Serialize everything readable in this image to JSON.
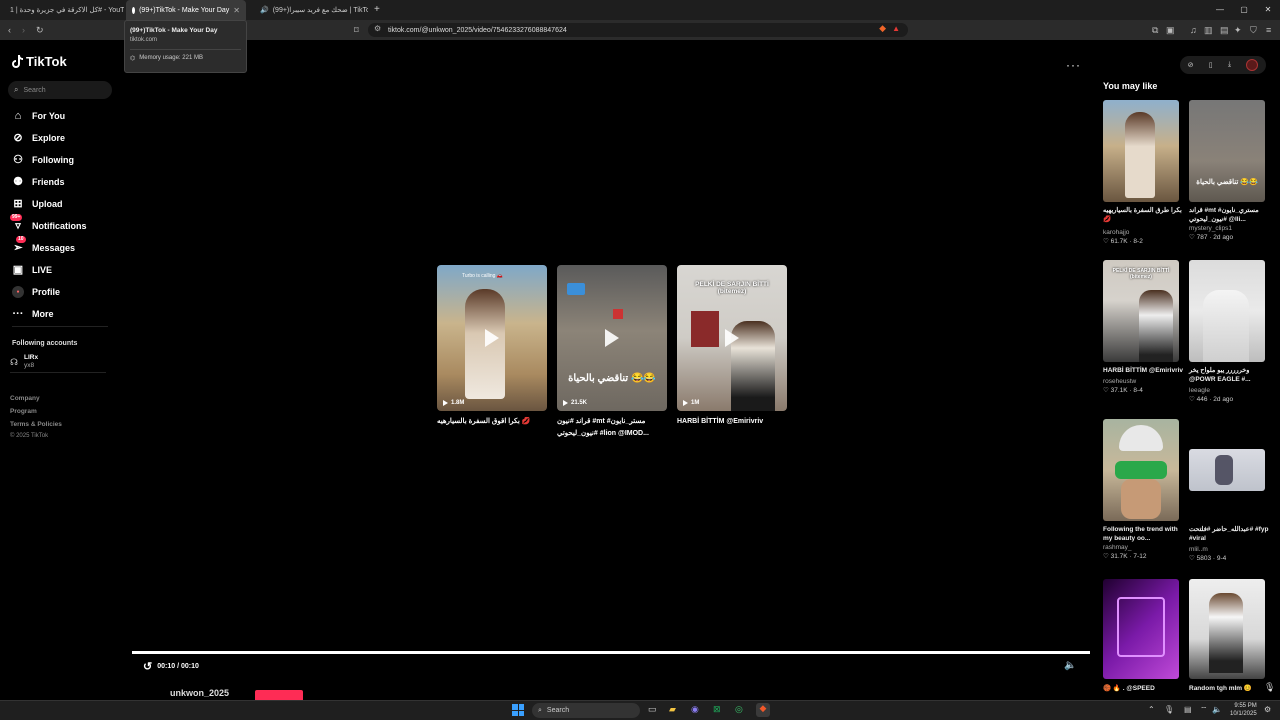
{
  "browser": {
    "tabs": [
      {
        "title": "كل الاكرقة في جزيرة وحدة | 1# - YouTube"
      },
      {
        "title": "(99+)TikTok - Make Your Day"
      },
      {
        "title": "(99+)ضحك مع فريد سيبرا | TikTok"
      }
    ],
    "new_tab": "+",
    "url": "tiktok.com/@unkwon_2025/video/7546233276088847624",
    "tooltip": {
      "title": "(99+)TikTok - Make Your Day",
      "domain": "tiktok.com",
      "memory": "Memory usage: 221 MB"
    }
  },
  "sidebar": {
    "logo": "TikTok",
    "search_placeholder": "Search",
    "items": [
      {
        "label": "For You",
        "icon": "home-icon"
      },
      {
        "label": "Explore",
        "icon": "compass-icon"
      },
      {
        "label": "Following",
        "icon": "following-icon"
      },
      {
        "label": "Friends",
        "icon": "friends-icon"
      },
      {
        "label": "Upload",
        "icon": "upload-icon"
      },
      {
        "label": "Notifications",
        "icon": "inbox-icon",
        "badge": "99+"
      },
      {
        "label": "Messages",
        "icon": "messages-icon",
        "badge": "10"
      },
      {
        "label": "LIVE",
        "icon": "live-icon"
      },
      {
        "label": "Profile",
        "icon": "avatar-icon"
      },
      {
        "label": "More",
        "icon": "more-icon"
      }
    ],
    "following_heading": "Following accounts",
    "following_account": {
      "name": "LIRx",
      "handle": "yx8"
    },
    "footer": [
      "Company",
      "Program",
      "Terms & Policies",
      "© 2025 TikTok"
    ]
  },
  "main": {
    "cards": [
      {
        "views": "1.8M",
        "caption": "بكرا اقوق السفرة بالسيارهيه 💋",
        "overlay": "Turbo is calling 🚗"
      },
      {
        "views": "21.5K",
        "caption": "قراند #نيون #mt #مستر_نايون #نيون_ليحوتي #lion @IMOD...",
        "overlay": "😂😂 تناقضي بالحياة"
      },
      {
        "views": "1M",
        "caption": "HARBİ BİTTİM @Emirivriv",
        "overlay": "PELKİ DE SARJIN BİTTİ\n(bitemez)"
      }
    ],
    "time": "00:10 / 00:10",
    "progress": 1.0,
    "author": "unkwon_2025"
  },
  "right_panel": {
    "heading": "You may like",
    "items": [
      {
        "title": "بكرا طرق السفرة بالسياريهيه 💋",
        "user": "karohajjo",
        "likes": "61.7K",
        "date": "8-2"
      },
      {
        "title": "قراند #mt #مستري_نايون #نيون_ليحوتي @lli...",
        "user": "mystery_clips1",
        "likes": "787",
        "date": "2d ago"
      },
      {
        "title": "HARBİ BİTTİM @Emirivriv",
        "user": "roseheustw",
        "likes": "37.1K",
        "date": "8-4"
      },
      {
        "title": "وخررررر يبو ملواح يخر @POWR EAGLE #...",
        "user": "leeagle",
        "likes": "446",
        "date": "2d ago"
      },
      {
        "title": "Following the trend with my beauty oo...",
        "user": "rashmay_",
        "likes": "31.7K",
        "date": "7-12"
      },
      {
        "title": "عبدالله_حاضر #فلتحت# #fyp #viral",
        "user": "mlil..m",
        "likes": "5803",
        "date": "9-4"
      },
      {
        "title": "🏀 🔥 . @SPEED",
        "user": "",
        "likes": "",
        "date": ""
      },
      {
        "title": "Random tgh mlm 😊",
        "user": "",
        "likes": "",
        "date": ""
      }
    ]
  },
  "taskbar": {
    "search_placeholder": "Search",
    "time": "9:55 PM",
    "date": "10/1/2025"
  },
  "colors": {
    "accent": "#fe2c55",
    "bg": "#000000"
  }
}
